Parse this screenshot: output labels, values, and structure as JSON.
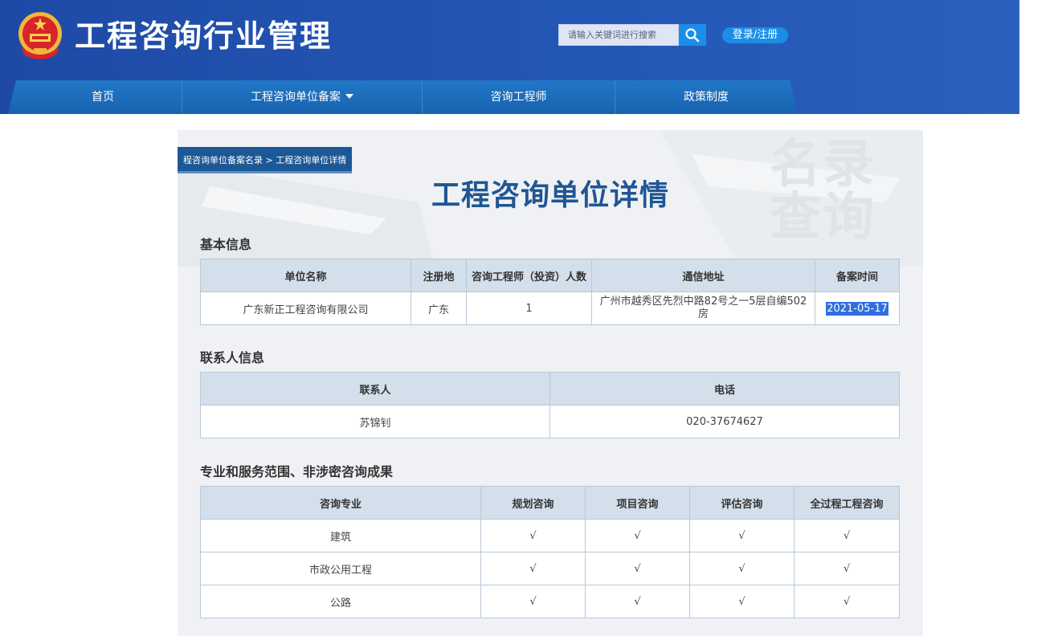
{
  "header": {
    "site_title": "工程咨询行业管理",
    "search_placeholder": "请输入关键词进行搜索",
    "login_label": "登录/注册"
  },
  "nav": {
    "items": [
      {
        "label": "首页"
      },
      {
        "label": "工程咨询单位备案"
      },
      {
        "label": "咨询工程师"
      },
      {
        "label": "政策制度"
      }
    ]
  },
  "breadcrumb": {
    "parent": "程咨询单位备案名录",
    "separator": " > ",
    "current": "工程咨询单位详情"
  },
  "watermark": {
    "line1": "名录",
    "line2": "查询"
  },
  "page_title": "工程咨询单位详情",
  "basic_info": {
    "title": "基本信息",
    "headers": [
      "单位名称",
      "注册地",
      "咨询工程师（投资）人数",
      "通信地址",
      "备案时间"
    ],
    "row": {
      "name": "广东新正工程咨询有限公司",
      "region": "广东",
      "engineer_count": "1",
      "address": "广州市越秀区先烈中路82号之一5层自编502房",
      "filing_date": "2021-05-17"
    }
  },
  "contact_info": {
    "title": "联系人信息",
    "headers": [
      "联系人",
      "电话"
    ],
    "row": {
      "contact": "苏锦钊",
      "phone": "020-37674627"
    }
  },
  "services": {
    "title": "专业和服务范围、非涉密咨询成果",
    "headers": [
      "咨询专业",
      "规划咨询",
      "项目咨询",
      "评估咨询",
      "全过程工程咨询"
    ],
    "rows": [
      {
        "specialty": "建筑",
        "c1": "√",
        "c2": "√",
        "c3": "√",
        "c4": "√"
      },
      {
        "specialty": "市政公用工程",
        "c1": "√",
        "c2": "√",
        "c3": "√",
        "c4": "√"
      },
      {
        "specialty": "公路",
        "c1": "√",
        "c2": "√",
        "c3": "√",
        "c4": "√"
      }
    ]
  },
  "colors": {
    "header_blue": "#2456b5",
    "nav_blue": "#1f6cb9",
    "accent_blue": "#1a8ee8",
    "title_blue": "#1f5693",
    "table_header": "#d3dfea"
  }
}
